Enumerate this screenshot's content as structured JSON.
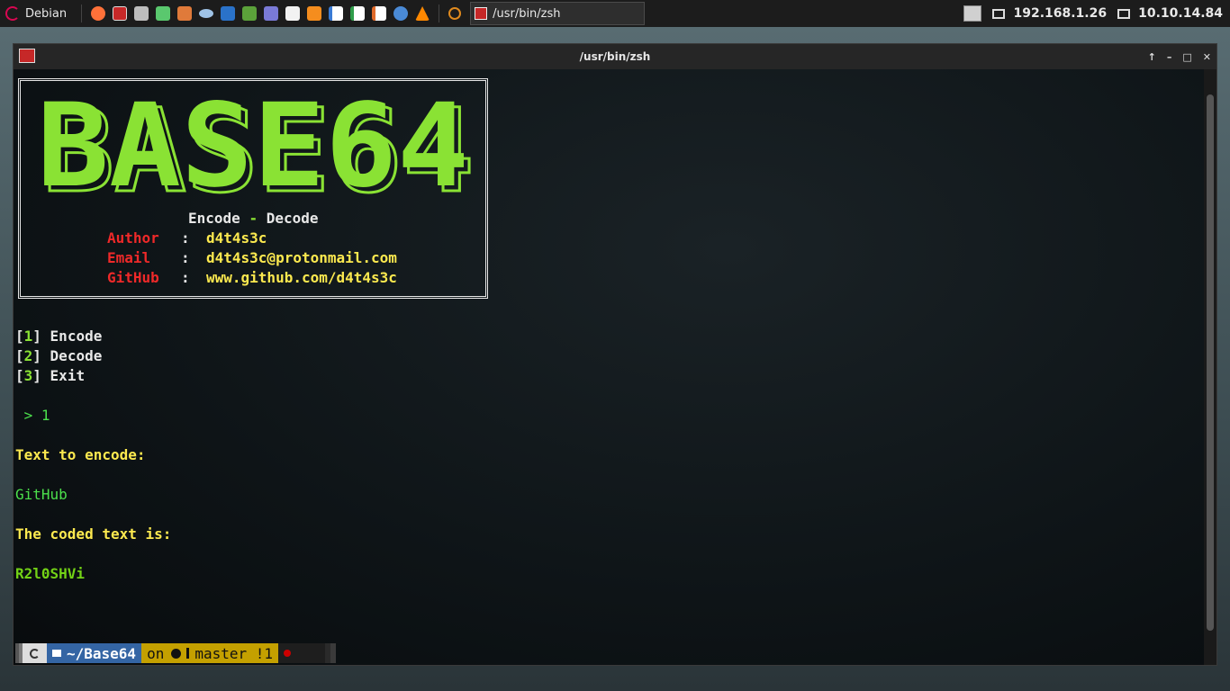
{
  "taskbar": {
    "start_label": "Debian",
    "launchers": [
      "firefox-icon",
      "terminal-icon",
      "files-icon",
      "network-icon",
      "archive-icon",
      "eye-icon",
      "wireshark-icon",
      "burp-icon",
      "bug-icon",
      "editor-icon",
      "sublime-icon",
      "document-icon",
      "spreadsheet-icon",
      "presentation-icon",
      "chromium-icon",
      "vlc-icon",
      "search-icon"
    ],
    "task_title": "/usr/bin/zsh",
    "ip_local": "192.168.1.26",
    "ip_vpn": "10.10.14.84"
  },
  "window": {
    "title": "/usr/bin/zsh",
    "controls": [
      "↑",
      "–",
      "□",
      "✕"
    ]
  },
  "banner": {
    "logo_text": "BASE64",
    "subtitle_encode": "Encode",
    "subtitle_dash": "-",
    "subtitle_decode": "Decode",
    "author_label": "Author",
    "author_value": "d4t4s3c",
    "email_label": "Email",
    "email_value": "d4t4s3c@protonmail.com",
    "github_label": "GitHub",
    "github_value": "www.github.com/d4t4s3c",
    "colon": ":"
  },
  "menu": [
    {
      "num": "1",
      "label": "Encode"
    },
    {
      "num": "2",
      "label": "Decode"
    },
    {
      "num": "3",
      "label": "Exit"
    }
  ],
  "session": {
    "input_prompt": " > 1",
    "text_prompt": "Text to encode:",
    "input_text": "GitHub",
    "result_prompt": "The coded text is:",
    "result": "R2l0SHVi"
  },
  "prompt_bar": {
    "dir": "~/Base64",
    "vcs_on": "on",
    "branch": "master !1"
  },
  "colors": {
    "green": "#8ae234",
    "red": "#ef2929",
    "yellow": "#fce94f",
    "dir_blue": "#3465a4",
    "git_yellow": "#c4a000"
  }
}
